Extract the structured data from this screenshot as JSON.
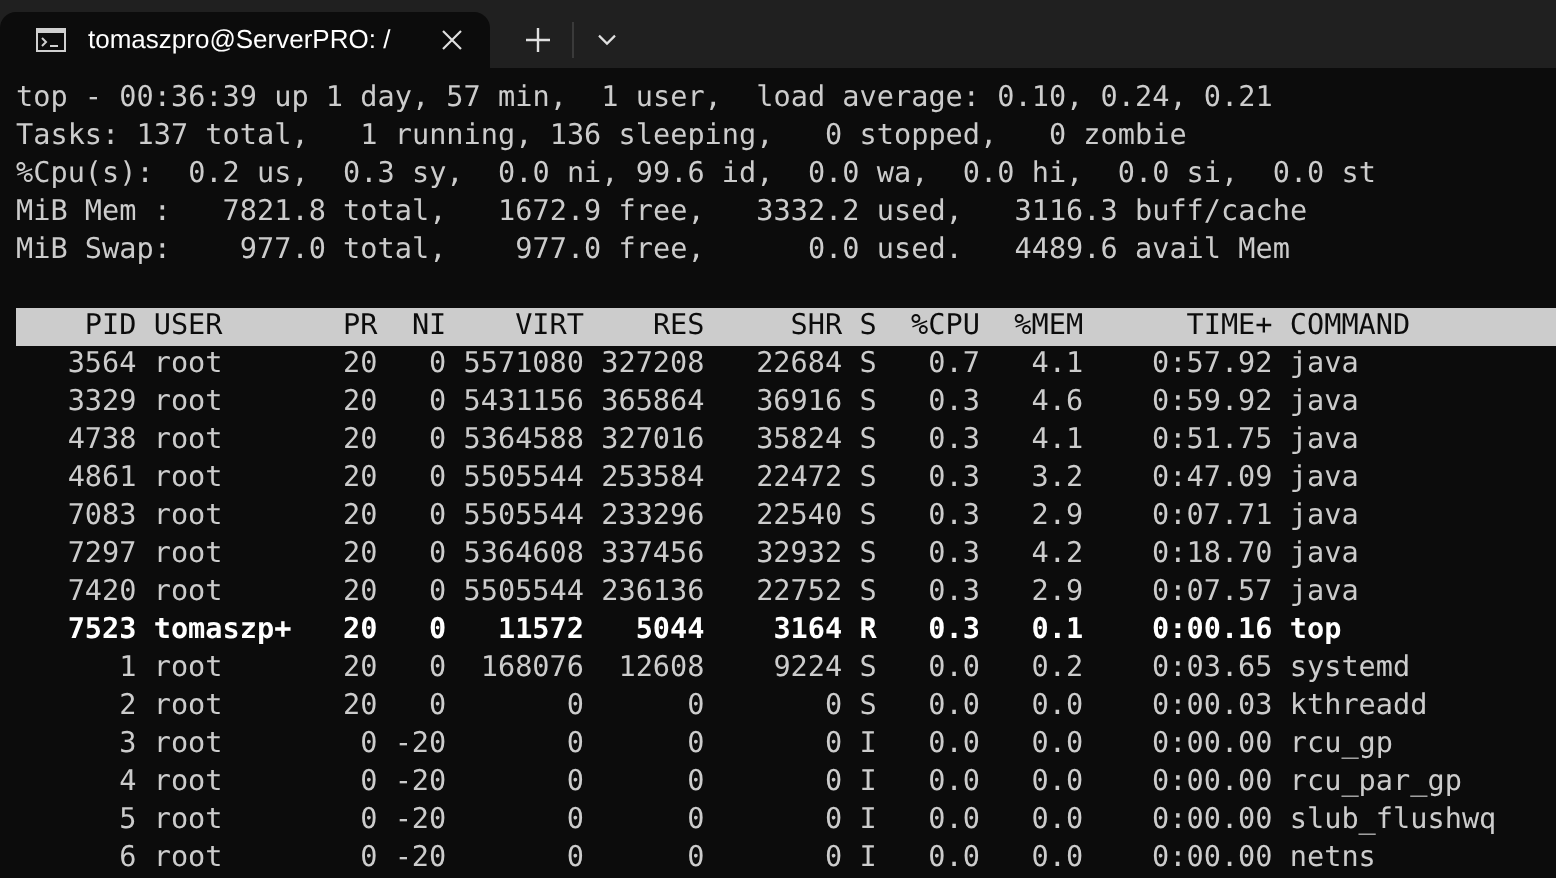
{
  "tab": {
    "title": "tomaszpro@ServerPRO: /",
    "selected": true
  },
  "summary": [
    "top - 00:36:39 up 1 day, 57 min,  1 user,  load average: 0.10, 0.24, 0.21",
    "Tasks: 137 total,   1 running, 136 sleeping,   0 stopped,   0 zombie",
    "%Cpu(s):  0.2 us,  0.3 sy,  0.0 ni, 99.6 id,  0.0 wa,  0.0 hi,  0.0 si,  0.0 st",
    "MiB Mem :   7821.8 total,   1672.9 free,   3332.2 used,   3116.3 buff/cache",
    "MiB Swap:    977.0 total,    977.0 free,      0.0 used.   4489.6 avail Mem"
  ],
  "table": {
    "columns": [
      "PID",
      "USER",
      "PR",
      "NI",
      "VIRT",
      "RES",
      "SHR",
      "S",
      "%CPU",
      "%MEM",
      "TIME+",
      "COMMAND"
    ],
    "rows": [
      {
        "bold": false,
        "cells": [
          "3564",
          "root",
          "20",
          "0",
          "5571080",
          "327208",
          "22684",
          "S",
          "0.7",
          "4.1",
          "0:57.92",
          "java"
        ]
      },
      {
        "bold": false,
        "cells": [
          "3329",
          "root",
          "20",
          "0",
          "5431156",
          "365864",
          "36916",
          "S",
          "0.3",
          "4.6",
          "0:59.92",
          "java"
        ]
      },
      {
        "bold": false,
        "cells": [
          "4738",
          "root",
          "20",
          "0",
          "5364588",
          "327016",
          "35824",
          "S",
          "0.3",
          "4.1",
          "0:51.75",
          "java"
        ]
      },
      {
        "bold": false,
        "cells": [
          "4861",
          "root",
          "20",
          "0",
          "5505544",
          "253584",
          "22472",
          "S",
          "0.3",
          "3.2",
          "0:47.09",
          "java"
        ]
      },
      {
        "bold": false,
        "cells": [
          "7083",
          "root",
          "20",
          "0",
          "5505544",
          "233296",
          "22540",
          "S",
          "0.3",
          "2.9",
          "0:07.71",
          "java"
        ]
      },
      {
        "bold": false,
        "cells": [
          "7297",
          "root",
          "20",
          "0",
          "5364608",
          "337456",
          "32932",
          "S",
          "0.3",
          "4.2",
          "0:18.70",
          "java"
        ]
      },
      {
        "bold": false,
        "cells": [
          "7420",
          "root",
          "20",
          "0",
          "5505544",
          "236136",
          "22752",
          "S",
          "0.3",
          "2.9",
          "0:07.57",
          "java"
        ]
      },
      {
        "bold": true,
        "cells": [
          "7523",
          "tomaszp+",
          "20",
          "0",
          "11572",
          "5044",
          "3164",
          "R",
          "0.3",
          "0.1",
          "0:00.16",
          "top"
        ]
      },
      {
        "bold": false,
        "cells": [
          "1",
          "root",
          "20",
          "0",
          "168076",
          "12608",
          "9224",
          "S",
          "0.0",
          "0.2",
          "0:03.65",
          "systemd"
        ]
      },
      {
        "bold": false,
        "cells": [
          "2",
          "root",
          "20",
          "0",
          "0",
          "0",
          "0",
          "S",
          "0.0",
          "0.0",
          "0:00.03",
          "kthreadd"
        ]
      },
      {
        "bold": false,
        "cells": [
          "3",
          "root",
          "0",
          "-20",
          "0",
          "0",
          "0",
          "I",
          "0.0",
          "0.0",
          "0:00.00",
          "rcu_gp"
        ]
      },
      {
        "bold": false,
        "cells": [
          "4",
          "root",
          "0",
          "-20",
          "0",
          "0",
          "0",
          "I",
          "0.0",
          "0.0",
          "0:00.00",
          "rcu_par_gp"
        ]
      },
      {
        "bold": false,
        "cells": [
          "5",
          "root",
          "0",
          "-20",
          "0",
          "0",
          "0",
          "I",
          "0.0",
          "0.0",
          "0:00.00",
          "slub_flushwq"
        ]
      },
      {
        "bold": false,
        "cells": [
          "6",
          "root",
          "0",
          "-20",
          "0",
          "0",
          "0",
          "I",
          "0.0",
          "0.0",
          "0:00.00",
          "netns"
        ]
      }
    ]
  }
}
